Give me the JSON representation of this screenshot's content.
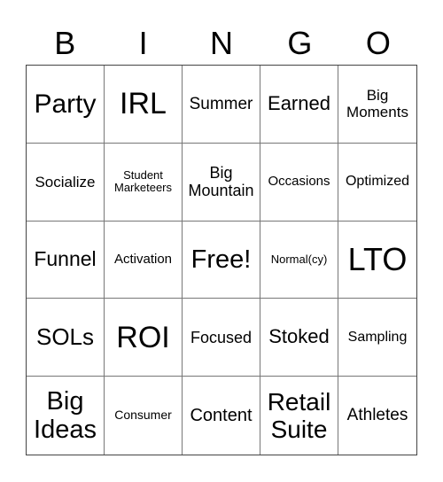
{
  "header": {
    "letters": [
      "B",
      "I",
      "N",
      "G",
      "O"
    ]
  },
  "cells": [
    [
      "Party",
      "IRL",
      "Summer",
      "Earned",
      "Big\nMoments"
    ],
    [
      "Socialize",
      "Student\nMarketeers",
      "Big\nMountain",
      "Occasions",
      "Optimized"
    ],
    [
      "Funnel",
      "Activation",
      "Free!",
      "Normal(cy)",
      "LTO"
    ],
    [
      "SOLs",
      "ROI",
      "Focused",
      "Stoked",
      "Sampling"
    ],
    [
      "Big\nIdeas",
      "Consumer",
      "Content",
      "Retail\nSuite",
      "Athletes"
    ]
  ]
}
